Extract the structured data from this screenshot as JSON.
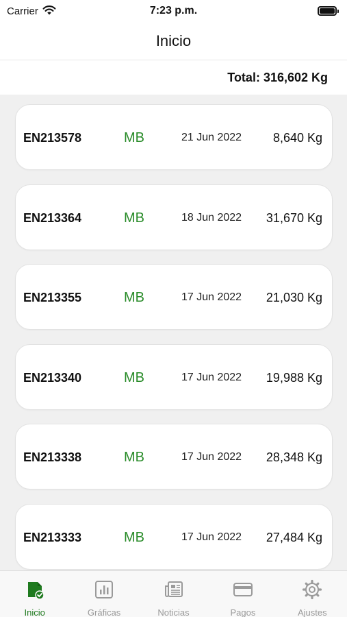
{
  "status": {
    "carrier": "Carrier",
    "time": "7:23 p.m."
  },
  "nav": {
    "title": "Inicio"
  },
  "total": {
    "label": "Total: 316,602 Kg"
  },
  "rows": [
    {
      "code": "EN213578",
      "grade": "MB",
      "date": "21 Jun 2022",
      "weight": "8,640 Kg"
    },
    {
      "code": "EN213364",
      "grade": "MB",
      "date": "18 Jun 2022",
      "weight": "31,670 Kg"
    },
    {
      "code": "EN213355",
      "grade": "MB",
      "date": "17 Jun 2022",
      "weight": "21,030 Kg"
    },
    {
      "code": "EN213340",
      "grade": "MB",
      "date": "17 Jun 2022",
      "weight": "19,988 Kg"
    },
    {
      "code": "EN213338",
      "grade": "MB",
      "date": "17 Jun 2022",
      "weight": "28,348 Kg"
    },
    {
      "code": "EN213333",
      "grade": "MB",
      "date": "17 Jun 2022",
      "weight": "27,484 Kg"
    }
  ],
  "tabs": [
    {
      "label": "Inicio",
      "icon": "home-document-icon",
      "active": true
    },
    {
      "label": "Gráficas",
      "icon": "chart-icon",
      "active": false
    },
    {
      "label": "Noticias",
      "icon": "newspaper-icon",
      "active": false
    },
    {
      "label": "Pagos",
      "icon": "credit-card-icon",
      "active": false
    },
    {
      "label": "Ajustes",
      "icon": "gear-icon",
      "active": false
    }
  ],
  "colors": {
    "accent": "#1f7a1f",
    "grade": "#2a8c2a",
    "inactive": "#9a9a9a",
    "list_bg": "#f0f0f0"
  }
}
